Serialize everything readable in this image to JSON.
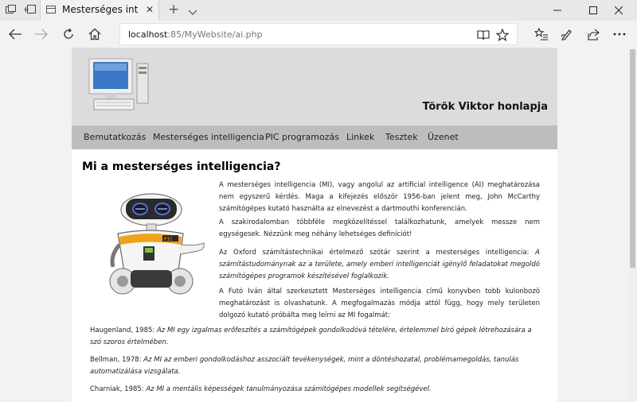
{
  "browser": {
    "tab_title": "Mesterséges intelligencia",
    "url_host": "localhost",
    "url_rest": ":85/MyWebsite/ai.php"
  },
  "site": {
    "title": "Török Viktor honlapja",
    "nav": [
      "Bemutatkozás",
      "Mesterséges intelligencia",
      "PIC programozás",
      "Linkek",
      "Tesztek",
      "Üzenet"
    ],
    "heading": "Mi a mesterséges intelligencia?",
    "paragraphs": {
      "p1": "A mesterséges intelligencia (MI), vagy angolul az artificial intelligence (AI) meghatározása nem egyszerű kérdés. Maga a kifejezés először 1956-ban jelent meg, John McCarthy számítógépes kutató használta az elnevezést a dartmouthi konferencián.",
      "p2": "A szakirodalomban többféle megközelítéssel találkozhatunk, amelyek messze nem egységesek. Nézzünk meg néhány lehetséges definíciót!",
      "p3_lead": "Az Oxford számítástechnikai értelmező szótár szerint a mesterséges intelligencia: ",
      "p3_quote": "A számítástudománynak az a területe, amely emberi intelligenciát igénylő feladatokat megoldó számítógépes programok készítésével foglalkozik.",
      "p4": "A Futó Iván által szerkesztett Mesterséges intelligencia című konyvben tobb kulonbozö meghatározást is olvashatunk. A megfogalmazás módja attól függ, hogy mely területen dolgozó kutató próbálta meg leírni az MI fogalmát:",
      "q1_author": "Haugenland, 1985: ",
      "q1_text": "Az MI egy izgalmas erőfeszítés a számítógépek gondolkodóvá tételére, értelemmel bíró gépek létrehozására a szó szoros értelmében.",
      "q2_author": "Bellman, 1978: ",
      "q2_text": "Az MI az emberi gondolkodáshoz asszociált tevékenységek, mint a döntéshozatal, problémamegoldás, tanulás automatizálása vizsgálata.",
      "q3_author": "Charniak, 1985: ",
      "q3_text": "Az MI a mentális képességek tanulmányozása számítógépes modellek segítségével."
    }
  }
}
